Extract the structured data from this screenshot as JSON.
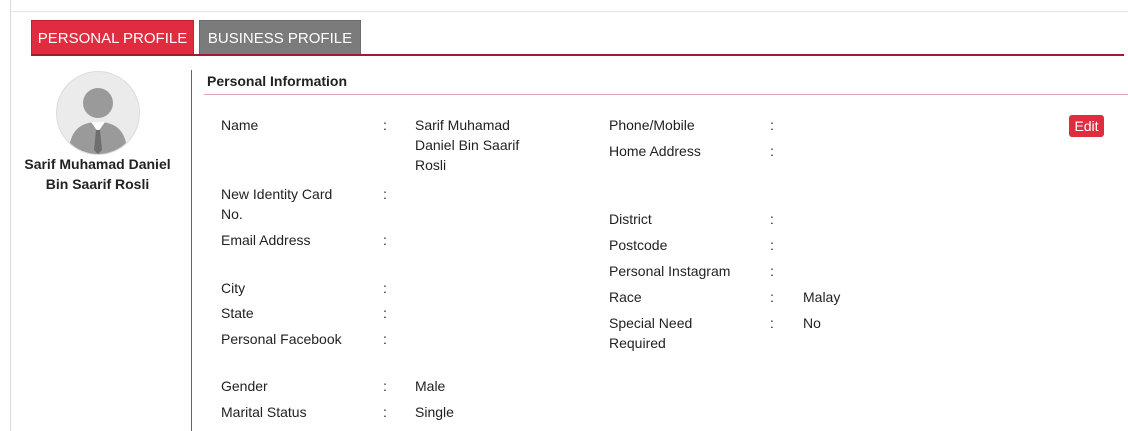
{
  "tabs": {
    "personal": "PERSONAL PROFILE",
    "business": "BUSINESS PROFILE"
  },
  "profile": {
    "name": "Sarif Muhamad Daniel Bin Saarif Rosli"
  },
  "section": {
    "title": "Personal Information",
    "edit_label": "Edit"
  },
  "colon": ":",
  "left_fields": [
    {
      "label": "Name",
      "value": "Sarif Muhamad Daniel Bin Saarif Rosli"
    },
    {
      "label": "New Identity Card No.",
      "value": ""
    },
    {
      "label": "Email Address",
      "value": ""
    },
    {
      "label": "City",
      "value": ""
    },
    {
      "label": "State",
      "value": ""
    },
    {
      "label": "Personal Facebook",
      "value": ""
    },
    {
      "label": "Gender",
      "value": "Male"
    },
    {
      "label": "Marital Status",
      "value": "Single"
    }
  ],
  "right_fields": [
    {
      "label": "Phone/Mobile",
      "value": ""
    },
    {
      "label": "Home Address",
      "value": ""
    },
    {
      "label": "District",
      "value": ""
    },
    {
      "label": "Postcode",
      "value": ""
    },
    {
      "label": "Personal Instagram",
      "value": ""
    },
    {
      "label": "Race",
      "value": "Malay"
    },
    {
      "label": "Special Need Required",
      "value": "No"
    }
  ],
  "colors": {
    "accent": "#df2d3f",
    "tab_inactive": "#7b7b7b",
    "tab_underline": "#9c1f2b"
  },
  "icons": {
    "avatar": "user-silhouette-icon"
  }
}
